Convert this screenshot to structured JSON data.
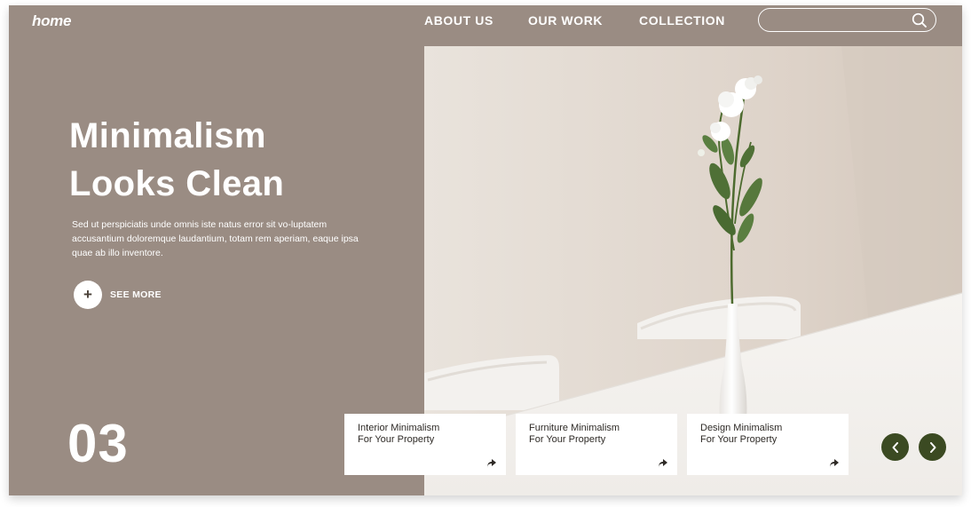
{
  "header": {
    "logo": "home",
    "nav": [
      {
        "label": "ABOUT US"
      },
      {
        "label": "OUR WORK"
      },
      {
        "label": "COLLECTION"
      }
    ],
    "search": {
      "placeholder": "",
      "icon": "search-icon"
    }
  },
  "hero": {
    "headline_line1": "Minimalism",
    "headline_line2": "Looks Clean",
    "description": "Sed ut perspiciatis unde omnis iste natus error sit vo-luptatem accusantium doloremque laudantium, totam rem aperiam, eaque ipsa quae ab illo inventore.",
    "see_more": {
      "icon": "plus",
      "label": "SEE MORE"
    },
    "image": "white vase with white flowers on table with chairs"
  },
  "slider": {
    "current": "03",
    "cards": [
      {
        "line1": "Interior Minimalism",
        "line2": "For Your Property",
        "icon": "share-arrow-icon"
      },
      {
        "line1": "Furniture Minimalism",
        "line2": "For Your Property",
        "icon": "share-arrow-icon"
      },
      {
        "line1": "Design Minimalism",
        "line2": "For Your Property",
        "icon": "share-arrow-icon"
      }
    ],
    "prev_icon": "chevron-left-icon",
    "next_icon": "chevron-right-icon"
  },
  "colors": {
    "background": "#9a8c83",
    "accent": "#3b4a22",
    "text": "#ffffff"
  }
}
